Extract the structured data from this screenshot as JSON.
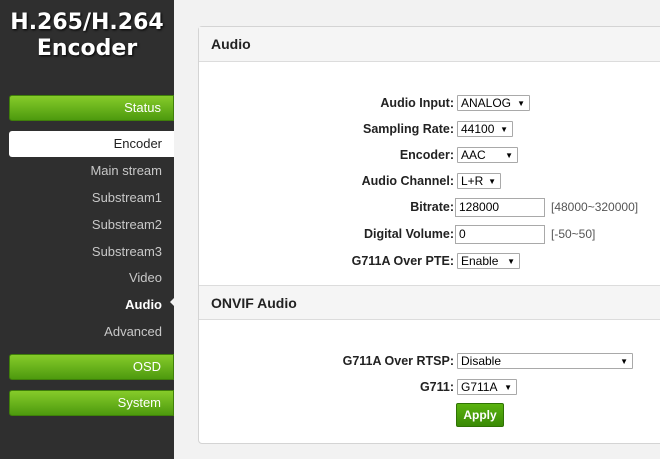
{
  "brand": {
    "line1": "H.265/H.264",
    "line2": "Encoder"
  },
  "sidebar": {
    "status": "Status",
    "encoder": "Encoder",
    "sub_items": [
      "Main stream",
      "Substream1",
      "Substream2",
      "Substream3",
      "Video",
      "Audio",
      "Advanced"
    ],
    "active_sub": "Audio",
    "osd": "OSD",
    "system": "System"
  },
  "audio": {
    "title": "Audio",
    "fields": [
      {
        "label": "Audio Input:",
        "value": "ANALOG"
      },
      {
        "label": "Sampling Rate:",
        "value": "44100"
      },
      {
        "label": "Encoder:",
        "value": "AAC"
      },
      {
        "label": "Audio Channel:",
        "value": "L+R"
      },
      {
        "label": "Bitrate:",
        "value": "128000",
        "hint": "[48000~320000]"
      },
      {
        "label": "Digital Volume:",
        "value": "0",
        "hint": "[-50~50]"
      },
      {
        "label": "G711A Over PTE:",
        "value": "Enable"
      }
    ]
  },
  "onvif": {
    "title": "ONVIF Audio",
    "fields": [
      {
        "label": "G711A Over RTSP:",
        "value": "Disable"
      },
      {
        "label": "G711:",
        "value": "G711A"
      }
    ],
    "apply_label": "Apply"
  },
  "colors": {
    "accent_green": "#5ab30f",
    "sidebar_bg": "#2f2f2f"
  }
}
